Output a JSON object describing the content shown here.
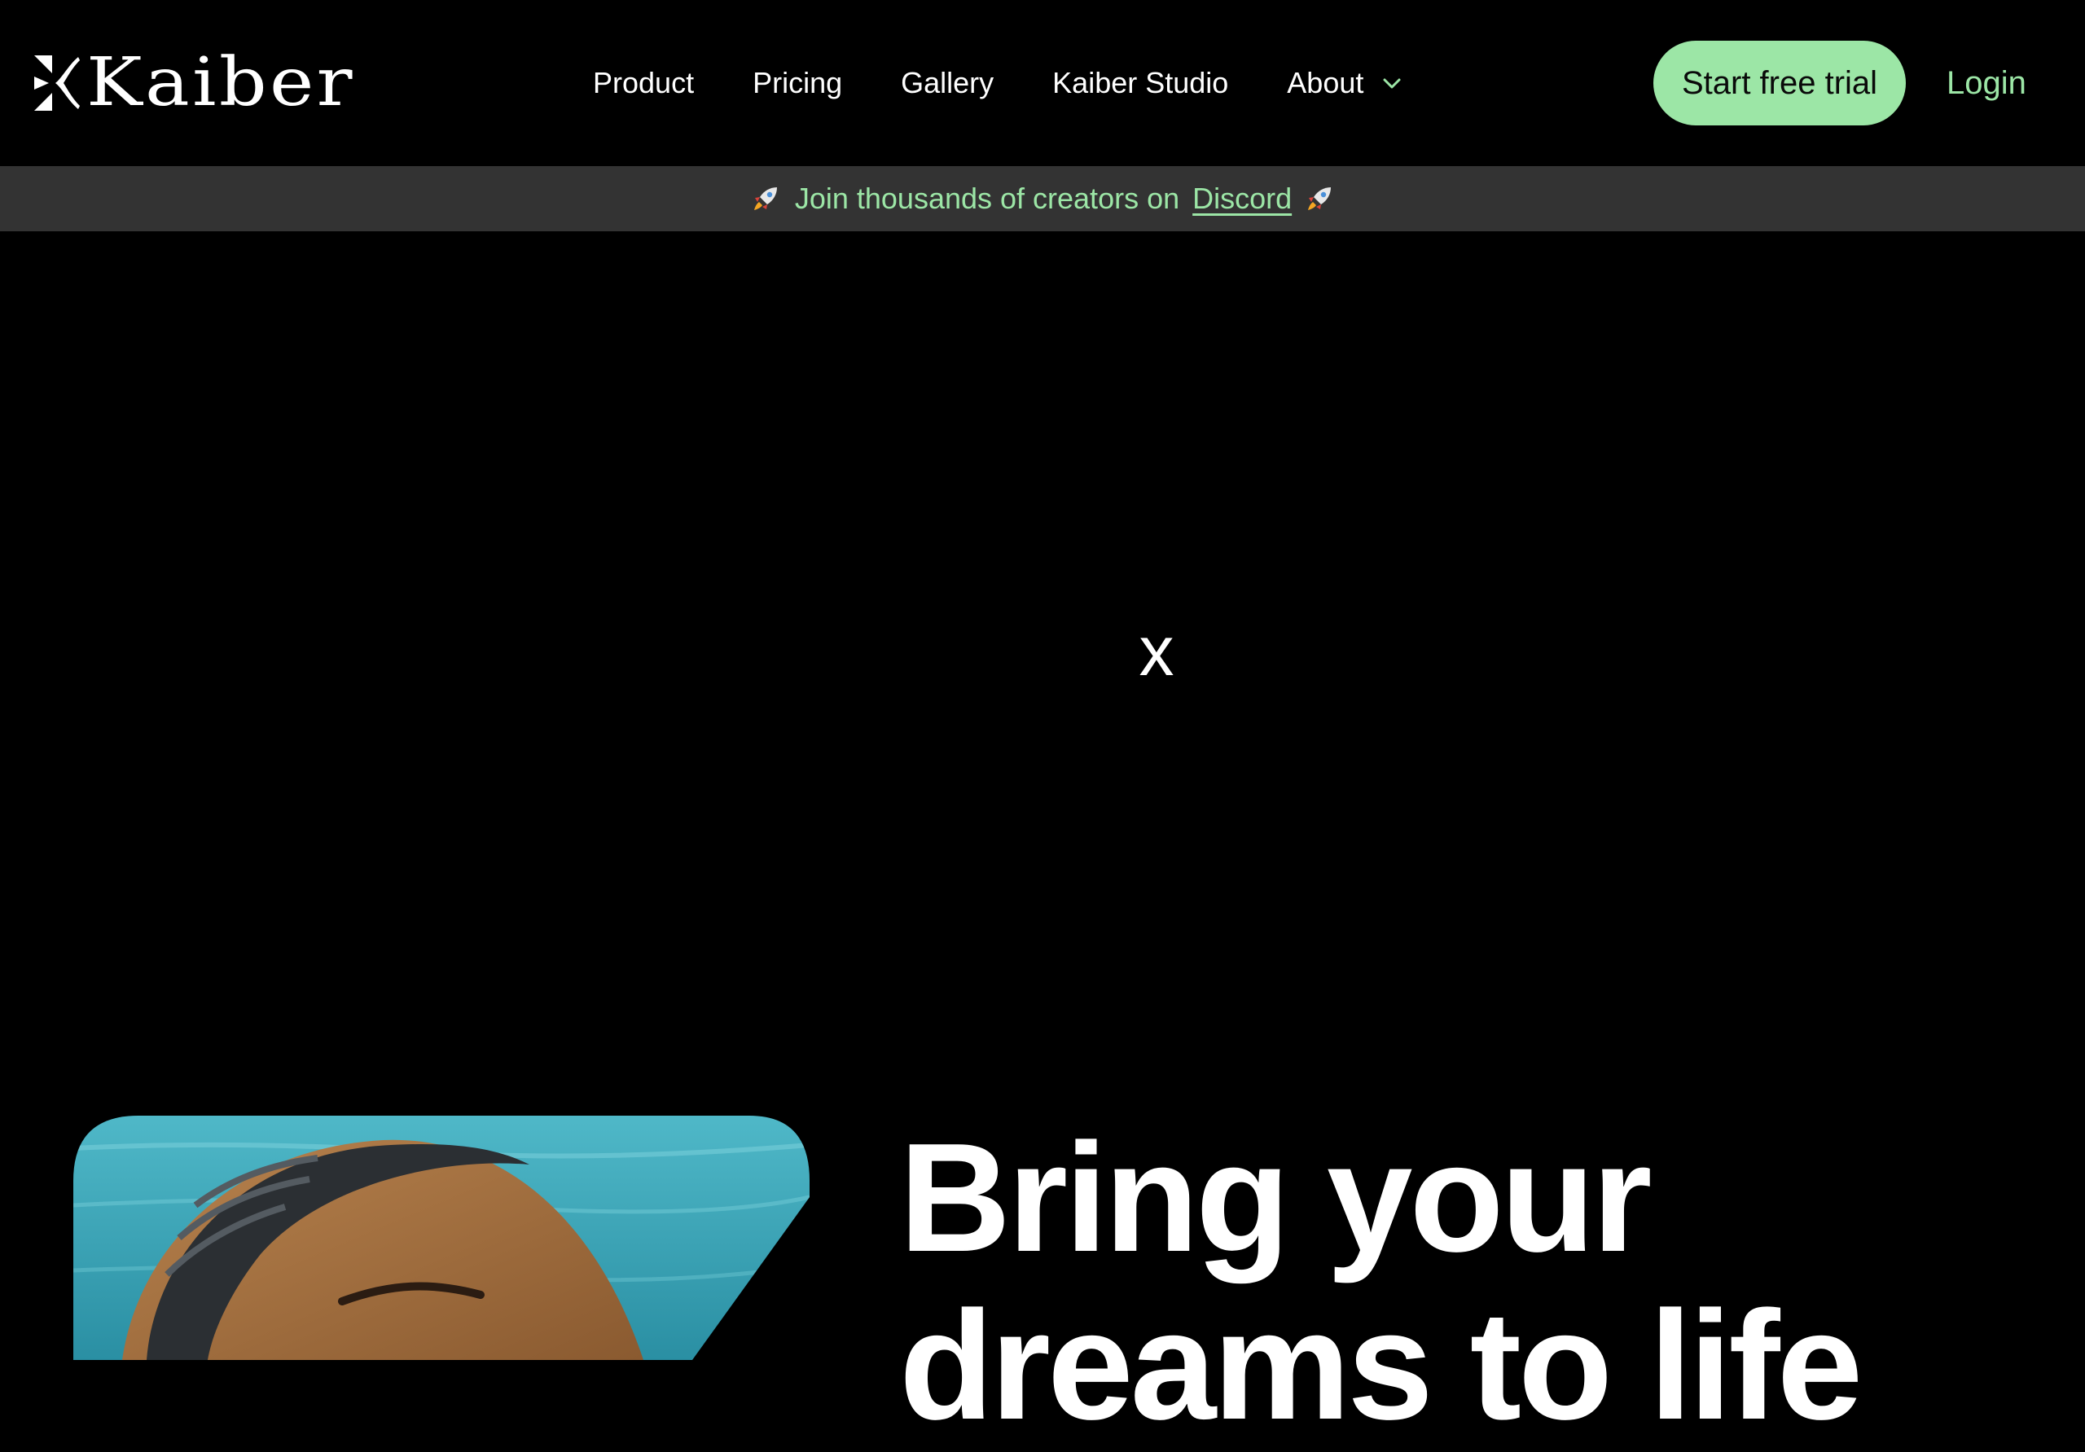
{
  "brand": {
    "name": "Kaiber",
    "logo_icon": "kaiber-k-mark"
  },
  "nav": {
    "items": [
      {
        "label": "Product"
      },
      {
        "label": "Pricing"
      },
      {
        "label": "Gallery"
      },
      {
        "label": "Kaiber Studio"
      },
      {
        "label": "About",
        "icon": "chevron-down-icon"
      }
    ]
  },
  "header": {
    "cta_label": "Start free trial",
    "login_label": "Login"
  },
  "banner": {
    "icon": "rocket-icon",
    "text": "Join thousands of creators on",
    "link_label": "Discord"
  },
  "hero": {
    "video_placeholder_text": "x",
    "heading_line1": "Bring your",
    "heading_line2": "dreams to life"
  },
  "colors": {
    "background": "#000000",
    "accent_green": "#9ce6a6",
    "banner_bg": "#333333",
    "text": "#ffffff"
  }
}
